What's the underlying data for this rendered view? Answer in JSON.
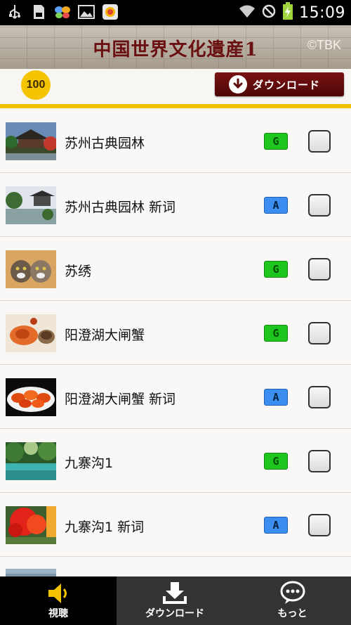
{
  "status_bar": {
    "time": "15:09",
    "left_icons": [
      "usb-icon",
      "sd-card-icon",
      "butterfly-app-icon",
      "image-icon",
      "store-app-icon"
    ],
    "right_icons": [
      "wifi-icon",
      "blocked-icon",
      "battery-charging-icon"
    ]
  },
  "header": {
    "title": "中国世界文化遺産1",
    "copyright": "©TBK"
  },
  "toolbar": {
    "count_badge": "100",
    "download_button_label": "ダウンロード"
  },
  "items": [
    {
      "label": "苏州古典园林",
      "tag": "G",
      "tag_color": "#1ec51e",
      "thumbnail": "garden-photo"
    },
    {
      "label": "苏州古典园林 新词",
      "tag": "A",
      "tag_color": "#3b8df0",
      "thumbnail": "garden-pavilion-photo"
    },
    {
      "label": "苏绣",
      "tag": "G",
      "tag_color": "#1ec51e",
      "thumbnail": "embroidered-cats-photo"
    },
    {
      "label": "阳澄湖大闸蟹",
      "tag": "G",
      "tag_color": "#1ec51e",
      "thumbnail": "crab-dish-photo"
    },
    {
      "label": "阳澄湖大闸蟹 新词",
      "tag": "A",
      "tag_color": "#3b8df0",
      "thumbnail": "crab-platter-photo"
    },
    {
      "label": "九寨沟1",
      "tag": "G",
      "tag_color": "#1ec51e",
      "thumbnail": "lake-forest-photo"
    },
    {
      "label": "九寨沟1 新词",
      "tag": "A",
      "tag_color": "#3b8df0",
      "thumbnail": "red-autumn-tree-photo"
    }
  ],
  "bottom_nav": [
    {
      "label": "視聴",
      "icon": "speaker-icon",
      "active": true
    },
    {
      "label": "ダウンロード",
      "icon": "download-tray-icon",
      "active": false
    },
    {
      "label": "もっと",
      "icon": "speech-bubble-more-icon",
      "active": false
    }
  ],
  "colors": {
    "accent_yellow": "#f0c300",
    "title_red": "#6b1010",
    "download_button": "#5e0b0b",
    "tag_g": "#1ec51e",
    "tag_a": "#3b8df0",
    "nav_bg": "#333333",
    "nav_active_bg": "#000000"
  }
}
